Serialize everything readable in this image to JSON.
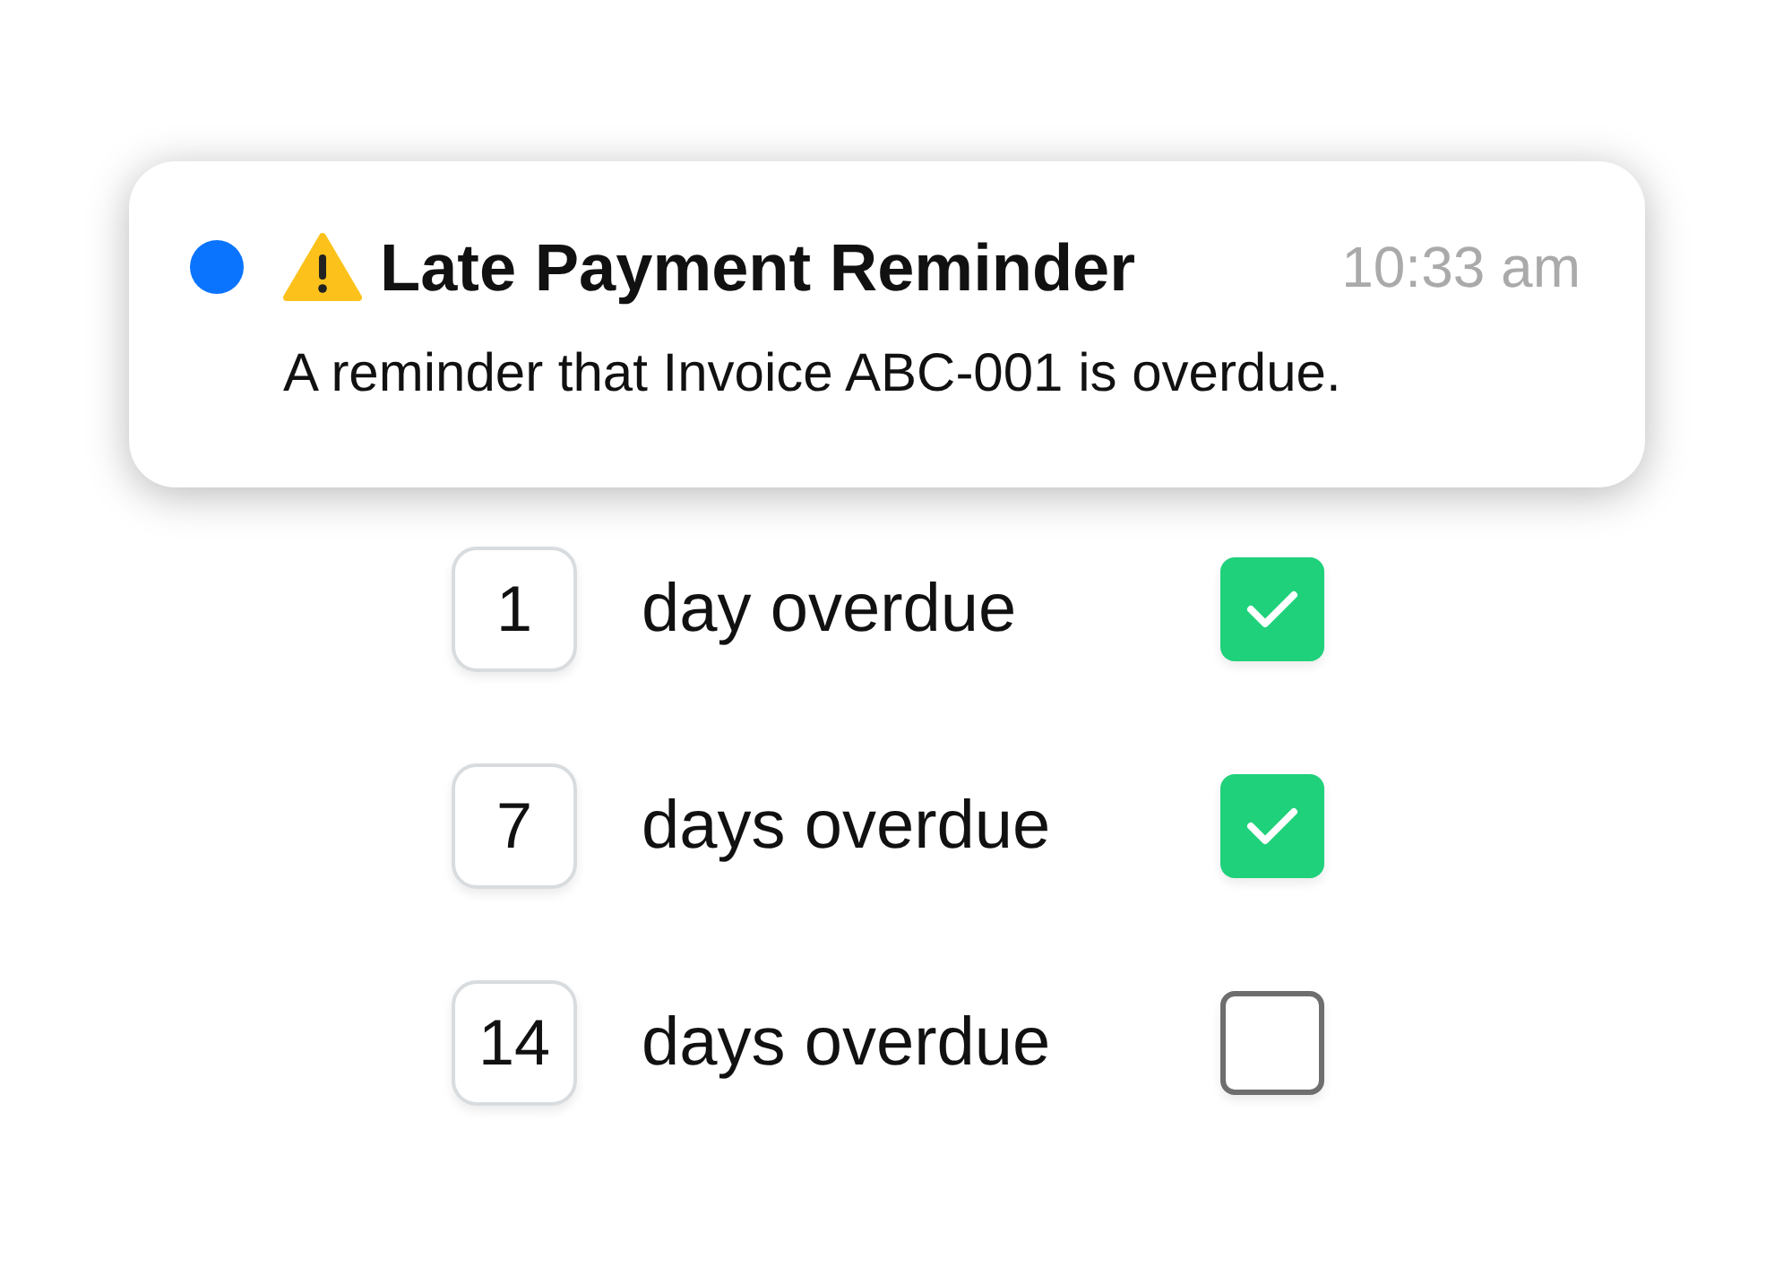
{
  "notification": {
    "unread": true,
    "title": "Late Payment Reminder",
    "time": "10:33 am",
    "message": "A reminder that Invoice ABC-001 is overdue."
  },
  "reminders": [
    {
      "number": "1",
      "label": "day overdue",
      "checked": true
    },
    {
      "number": "7",
      "label": "days overdue",
      "checked": true
    },
    {
      "number": "14",
      "label": "days overdue",
      "checked": false
    }
  ]
}
